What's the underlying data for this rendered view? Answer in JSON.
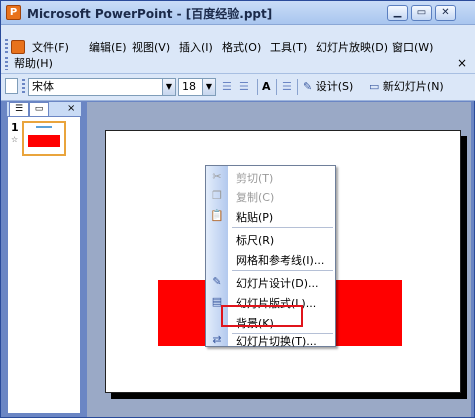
{
  "window": {
    "title": "Microsoft PowerPoint - [百度经验.ppt]",
    "minimize": "▁",
    "restore": "▭",
    "close": "✕"
  },
  "menubar": {
    "items": [
      "文件(F)",
      "编辑(E)",
      "视图(V)",
      "插入(I)",
      "格式(O)",
      "工具(T)",
      "幻灯片放映(D)",
      "窗口(W)",
      "帮助(H)"
    ],
    "close_mark": "×"
  },
  "toolbar": {
    "font_name": "宋体",
    "font_size": "18",
    "design_label": "设计(S)",
    "new_slide_label": "新幻灯片(N)"
  },
  "slide_pane": {
    "slide_number": "1",
    "close_tab": "×"
  },
  "colors": {
    "red_shape": "#ff0000",
    "highlight": "#e0141b",
    "accent": "#6b86c4"
  },
  "context_menu": {
    "items": [
      {
        "label": "剪切(T)",
        "icon": "scissors-icon",
        "disabled": true
      },
      {
        "label": "复制(C)",
        "icon": "copy-icon",
        "disabled": true
      },
      {
        "label": "粘贴(P)",
        "icon": "paste-icon",
        "disabled": false
      },
      {
        "label": "标尺(R)",
        "icon": "",
        "disabled": false
      },
      {
        "label": "网格和参考线(I)...",
        "icon": "",
        "disabled": false
      },
      {
        "label": "幻灯片设计(D)...",
        "icon": "slide-design-icon",
        "disabled": false
      },
      {
        "label": "幻灯片版式(L)...",
        "icon": "slide-layout-icon",
        "disabled": false
      },
      {
        "label": "背景(K)...",
        "icon": "",
        "disabled": false,
        "highlighted": true
      },
      {
        "label": "幻灯片切换(T)...",
        "icon": "slide-transition-icon",
        "disabled": false
      }
    ]
  }
}
